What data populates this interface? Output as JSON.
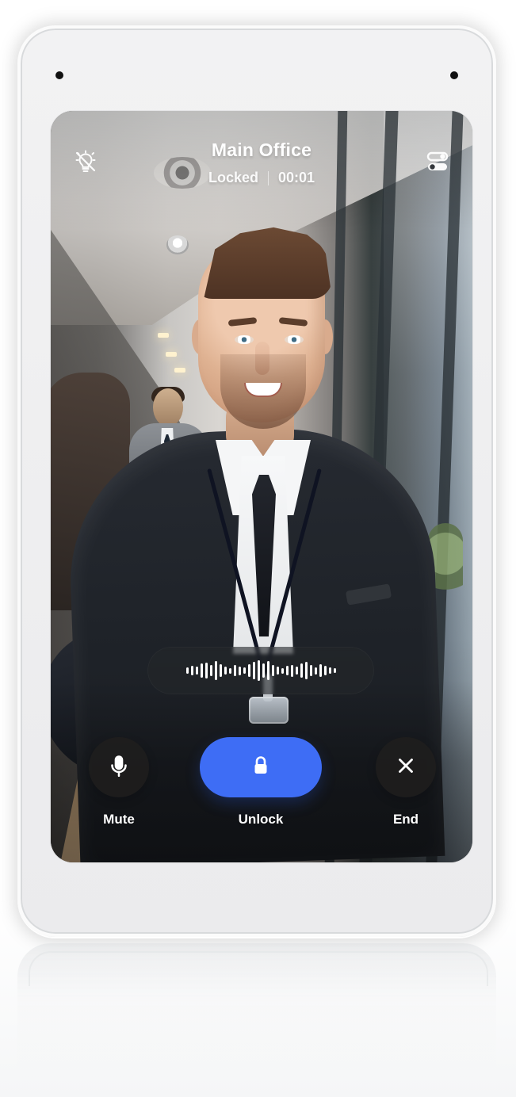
{
  "call_screen": {
    "title": "Main Office",
    "status": "Locked",
    "timer": "00:01"
  },
  "controls": {
    "mute_label": "Mute",
    "unlock_label": "Unlock",
    "end_label": "End"
  },
  "icons": {
    "top_left": "light-off-icon",
    "top_right": "toggle-settings-icon",
    "mute": "microphone-icon",
    "unlock": "lock-icon",
    "end": "close-icon"
  },
  "colors": {
    "accent": "#3e6df5",
    "control_dark": "#201f1e",
    "text": "#ffffff"
  }
}
